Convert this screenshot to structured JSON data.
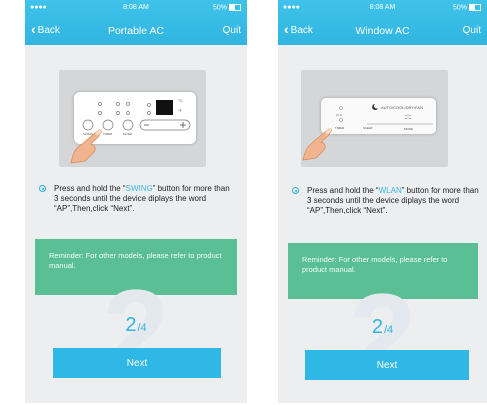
{
  "left": {
    "status": {
      "signal": "●●●● ",
      "time": "8:08 AM",
      "battery": "50%"
    },
    "nav": {
      "back": "Back",
      "title": "Portable AC",
      "quit": "Quit"
    },
    "panel_labels": {
      "swing": "SWING",
      "timer": "TIMER",
      "mode": "MODE",
      "celsius": "°C",
      "fahrenheit": "°F"
    },
    "instruction": {
      "pre": "Press and hold the “",
      "highlight": "SWING",
      "post": "” button for more than 3 seconds until the device diplays the word “AP”,Then,click “Next”."
    },
    "reminder": "Reminder: For other models, please refer to product manual.",
    "page": {
      "current": "2",
      "total": "4"
    },
    "next_label": "Next"
  },
  "right": {
    "status": {
      "signal": "●●●● ",
      "time": "8:08 AM",
      "battery": "50%"
    },
    "nav": {
      "back": "Back",
      "title": "Window AC",
      "quit": "Quit"
    },
    "panel_labels": {
      "modes": "AUTO/COOL/DRY/FAN",
      "timer": "TIMER",
      "sleep": "SLEEP",
      "mode": "MODE",
      "wifi_hint": "WI-FI"
    },
    "instruction": {
      "pre": "Press and hold the “",
      "highlight": "WLAN",
      "post": "” button for more than 3 seconds until the device diplays the word “AP”,Then,click “Next”."
    },
    "reminder": "Reminder: For other models, please refer to product manual.",
    "page": {
      "current": "2",
      "total": "4"
    },
    "next_label": "Next"
  },
  "colors": {
    "header": "#33b8e4",
    "reminder": "#5bbf95",
    "accent": "#3ab9e6"
  }
}
